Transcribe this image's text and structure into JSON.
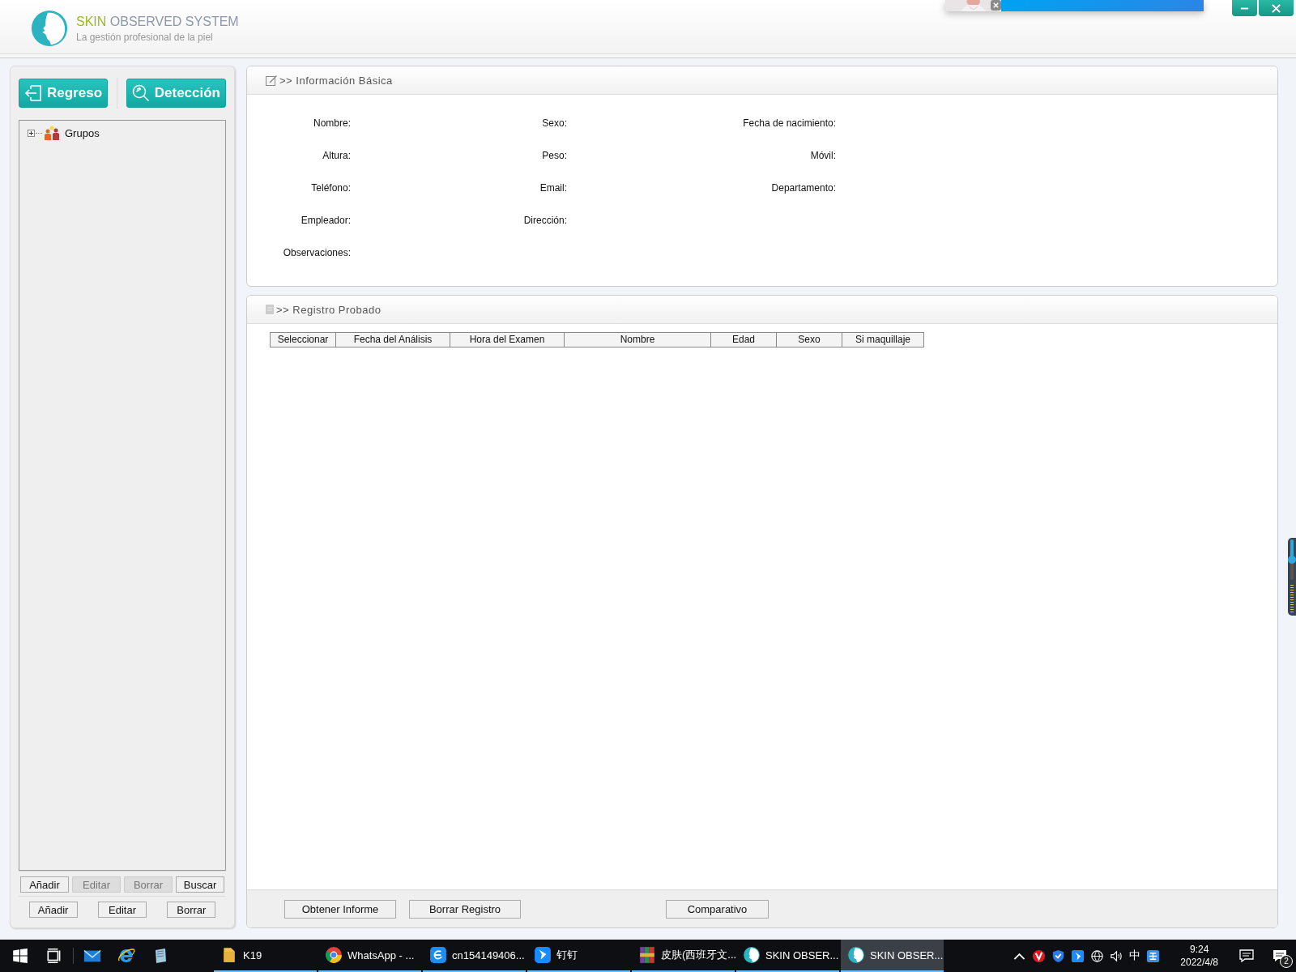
{
  "app": {
    "brand_accent": "SKIN",
    "brand_rest": "OBSERVED SYSTEM",
    "tagline": "La gestión profesional de la piel"
  },
  "left_panel": {
    "main_buttons": [
      "Regreso",
      "Detección"
    ],
    "tree": [
      {
        "label": "Grupos",
        "expanded": false
      }
    ],
    "group_buttons": [
      {
        "label": "Añadir",
        "disabled": false
      },
      {
        "label": "Editar",
        "disabled": true
      },
      {
        "label": "Borrar",
        "disabled": true
      },
      {
        "label": "Buscar",
        "disabled": false
      }
    ],
    "member_buttons": [
      {
        "label": "Añadir",
        "disabled": false
      },
      {
        "label": "Editar",
        "disabled": false
      },
      {
        "label": "Borrar",
        "disabled": false
      }
    ]
  },
  "info_panel": {
    "title": ">> Información Básica",
    "rows": [
      [
        "Nombre:",
        "Sexo:",
        "Fecha de nacimiento:"
      ],
      [
        "Altura:",
        "Peso:",
        "Móvil:"
      ],
      [
        "Teléfono:",
        "Email:",
        "Departamento:"
      ],
      [
        "Empleador:",
        "Dirección:"
      ],
      [
        "Observaciones:"
      ]
    ]
  },
  "record_panel": {
    "title": ">> Registro Probado",
    "columns": [
      "Seleccionar",
      "Fecha del Análisis",
      "Hora del Examen",
      "Nombre",
      "Edad",
      "Sexo",
      "Si maquillaje"
    ],
    "buttons": [
      "Obtener Informe",
      "Borrar Registro",
      "Comparativo"
    ]
  },
  "volume_slider": {
    "level": 0.5
  },
  "taskbar": {
    "apps": [
      {
        "label": "K19",
        "selected": false
      },
      {
        "label": "WhatsApp - ...",
        "selected": false
      },
      {
        "label": "cn154149406...",
        "selected": false
      },
      {
        "label": "钉钉",
        "selected": false
      },
      {
        "label": "皮肤(西班牙文...",
        "selected": false
      },
      {
        "label": "SKIN OBSER...",
        "selected": false
      },
      {
        "label": "SKIN OBSER...",
        "selected": true
      }
    ],
    "input_method": "中",
    "time": "9:24",
    "date": "2022/4/8",
    "notification_count": "2"
  }
}
